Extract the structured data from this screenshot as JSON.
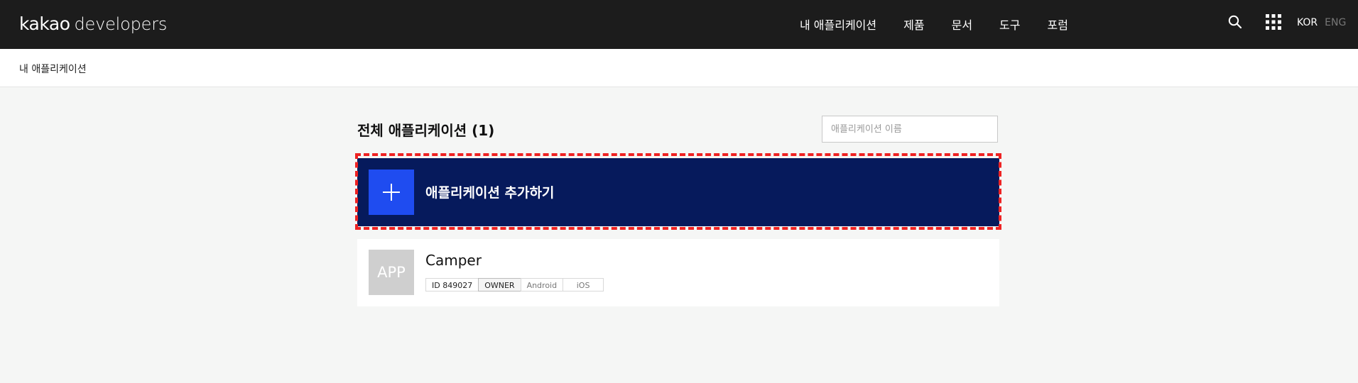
{
  "header": {
    "logo_brand": "kakao",
    "logo_product": "developers",
    "nav": [
      "내 애플리케이션",
      "제품",
      "문서",
      "도구",
      "포럼"
    ],
    "lang_kor": "KOR",
    "lang_eng": "ENG"
  },
  "breadcrumb": "내 애플리케이션",
  "main": {
    "title": "전체 애플리케이션 (1)",
    "search_placeholder": "애플리케이션 이름",
    "add_label": "애플리케이션 추가하기",
    "apps": [
      {
        "thumb": "APP",
        "name": "Camper",
        "tags": [
          "ID 849027",
          "OWNER",
          "Android",
          "iOS"
        ]
      }
    ]
  },
  "colors": {
    "header_bg": "#1c1c1c",
    "add_bg": "#061a5c",
    "accent": "#1f4cf0",
    "highlight": "#ee2222"
  }
}
